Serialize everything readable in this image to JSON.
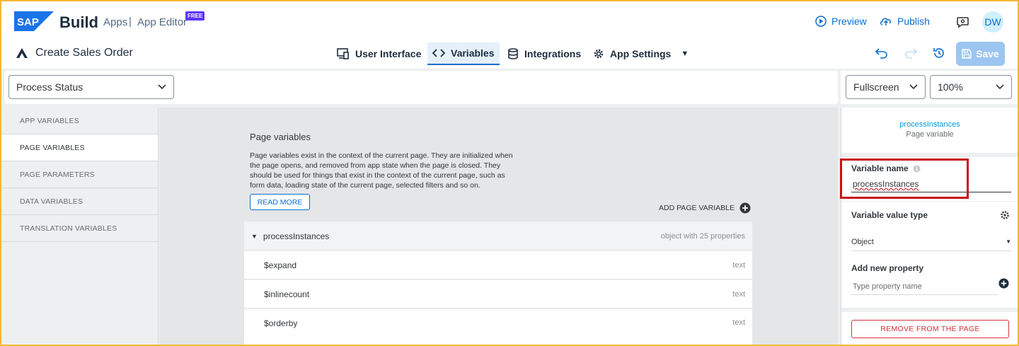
{
  "shell": {
    "brand": "Build",
    "apps": "Apps",
    "separator": "|",
    "app_editor": "App Editor",
    "badge": "FREE",
    "preview": "Preview",
    "publish": "Publish",
    "avatar": "DW",
    "logo_text": "SAP"
  },
  "toolbar": {
    "app_name": "Create Sales Order",
    "tabs": [
      {
        "label": "User Interface",
        "icon": "device-icon"
      },
      {
        "label": "Variables",
        "icon": "code-icon"
      },
      {
        "label": "Integrations",
        "icon": "database-icon"
      },
      {
        "label": "App Settings",
        "icon": "gear-icon"
      }
    ],
    "save": "Save"
  },
  "page_select": {
    "value": "Process Status"
  },
  "view_select": {
    "layout": "Fullscreen",
    "zoom": "100%"
  },
  "leftnav": {
    "items": [
      "APP VARIABLES",
      "PAGE VARIABLES",
      "PAGE PARAMETERS",
      "DATA VARIABLES",
      "TRANSLATION VARIABLES"
    ],
    "active_index": 1
  },
  "main": {
    "title": "Page variables",
    "description": "Page variables exist in the context of the current page. They are initialized when the page opens, and removed from app state when the page is closed. They should be used for things that exist in the context of the current page, such as form data, loading state of the current page, selected filters and so on.",
    "read_more": "READ MORE",
    "add_variable": "ADD PAGE VARIABLE",
    "variable": {
      "name": "processInstances",
      "type": "object with 25 properties"
    },
    "properties": [
      {
        "name": "$expand",
        "type": "text"
      },
      {
        "name": "$inlinecount",
        "type": "text"
      },
      {
        "name": "$orderby",
        "type": "text"
      }
    ]
  },
  "panel": {
    "header_name": "processInstances",
    "header_sub": "Page variable",
    "var_name_label": "Variable name",
    "var_name_value": "processInstances",
    "value_type_label": "Variable value type",
    "value_type": "Object",
    "add_prop_label": "Add new property",
    "add_prop_placeholder": "Type property name",
    "remove": "REMOVE FROM THE PAGE"
  },
  "colors": {
    "accent": "#0a6ed1",
    "highlight": "#c8101a",
    "frame": "#f5b731",
    "badge": "#5d36ff"
  }
}
